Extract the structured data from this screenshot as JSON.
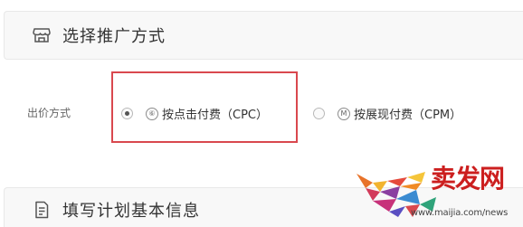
{
  "section1": {
    "icon": "store-icon",
    "title": "选择推广方式"
  },
  "bid_method": {
    "label": "出价方式",
    "options": [
      {
        "icon": "cpc-badge-icon",
        "icon_glyph": "⑥",
        "label": "按点击付费（CPC）",
        "selected": true
      },
      {
        "icon": "cpm-badge-icon",
        "icon_glyph": "M",
        "label": "按展现付费（CPM）",
        "selected": false
      }
    ]
  },
  "section2": {
    "icon": "document-icon",
    "title": "填写计划基本信息"
  },
  "watermark": {
    "title": "卖发网",
    "url": "www.maijia.com/news"
  },
  "colors": {
    "highlight_border": "#d9484e",
    "watermark_red": "#cc1f1f"
  }
}
